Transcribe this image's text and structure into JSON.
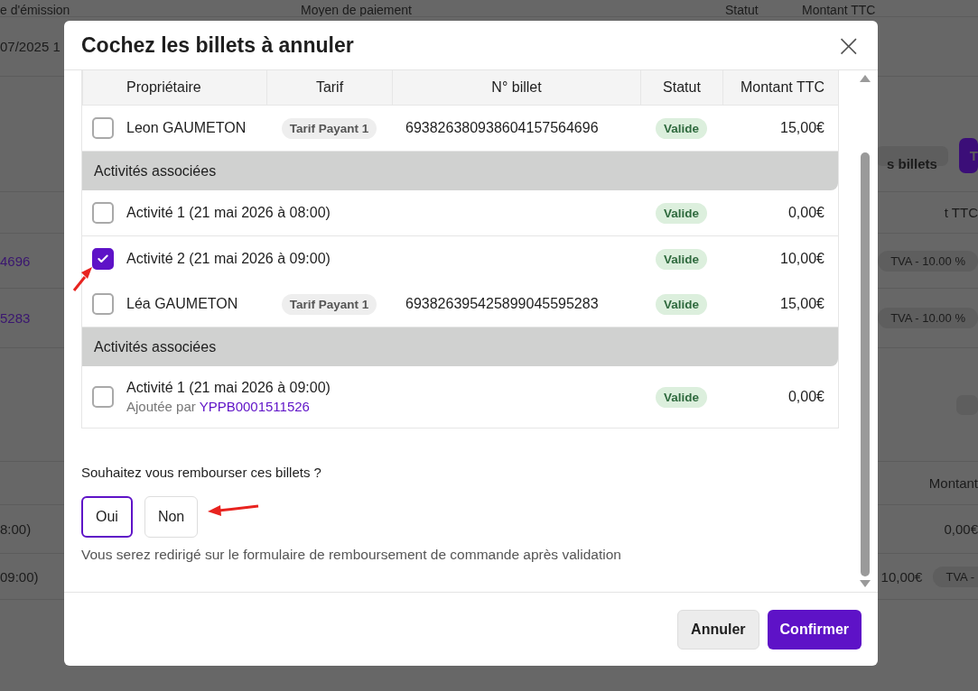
{
  "background": {
    "header": [
      "e d'émission",
      "Moyen de paiement",
      "Statut",
      "Montant TTC"
    ],
    "rows": [
      {
        "left": {
          "kind": "text",
          "text": "07/2025 1"
        },
        "right": []
      },
      {
        "left": null,
        "right": [
          {
            "kind": "button",
            "text": "s billets"
          },
          {
            "kind": "primary-button",
            "text": "T"
          }
        ]
      },
      {
        "left": null,
        "right": [
          {
            "kind": "text",
            "text": "t TTC"
          }
        ]
      },
      {
        "left": {
          "kind": "link",
          "text": "4696"
        },
        "right": [
          {
            "kind": "badge",
            "text": "TVA - 10.00 %"
          }
        ]
      },
      {
        "left": {
          "kind": "link",
          "text": "5283"
        },
        "right": [
          {
            "kind": "badge",
            "text": "TVA - 10.00 %"
          }
        ]
      },
      {
        "left": null,
        "right": [
          {
            "kind": "button"
          }
        ]
      },
      {
        "left": null,
        "right": [
          {
            "kind": "text",
            "text": "Montant"
          }
        ]
      },
      {
        "left": {
          "kind": "text",
          "text": "8:00)"
        },
        "right": [
          {
            "kind": "text",
            "text": "0,00€"
          }
        ]
      },
      {
        "left": {
          "kind": "text",
          "text": "09:00)"
        },
        "right": [
          {
            "kind": "text",
            "text": "10,00€"
          },
          {
            "kind": "badge",
            "text": "TVA -"
          }
        ]
      }
    ]
  },
  "modal": {
    "title": "Cochez les billets à annuler",
    "close": "×",
    "columns": [
      "Propriétaire",
      "Tarif",
      "N° billet",
      "Statut",
      "Montant TTC"
    ],
    "tickets": [
      {
        "owner": "Leon GAUMETON",
        "tarif": "Tarif Payant 1",
        "number": "693826380938604157564696",
        "status": "Valide",
        "amount": "15,00€",
        "checked": false,
        "group_label": "Activités associées",
        "activities": [
          {
            "label": "Activité 1 (21 mai 2026 à 08:00)",
            "status": "Valide",
            "amount": "0,00€",
            "checked": false
          },
          {
            "label": "Activité 2 (21 mai 2026 à 09:00)",
            "status": "Valide",
            "amount": "10,00€",
            "checked": true
          }
        ]
      },
      {
        "owner": "Léa GAUMETON",
        "tarif": "Tarif Payant 1",
        "number": "693826395425899045595283",
        "status": "Valide",
        "amount": "15,00€",
        "checked": false,
        "group_label": "Activités associées",
        "activities": [
          {
            "label": "Activité 1 (21 mai 2026 à 09:00)",
            "status": "Valide",
            "amount": "0,00€",
            "checked": false,
            "added_by": {
              "prefix": "Ajoutée par",
              "code": "YPPB0001511526"
            }
          }
        ]
      }
    ],
    "refund": {
      "question": "Souhaitez vous rembourser ces billets ?",
      "options": [
        {
          "label": "Oui",
          "selected": true
        },
        {
          "label": "Non",
          "selected": false
        }
      ],
      "note": "Vous serez redirigé sur le formulaire de remboursement de commande après validation"
    },
    "buttons": [
      {
        "kind": "secondary",
        "label": "Annuler"
      },
      {
        "kind": "primary",
        "label": "Confirmer"
      }
    ]
  }
}
